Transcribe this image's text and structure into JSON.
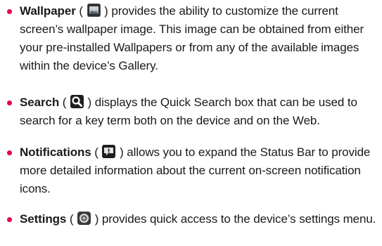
{
  "bullets": [
    {
      "term": "Wallpaper",
      "icon": "wallpaper-icon",
      "open": " ( ",
      "close": " ) ",
      "text": "provides the ability to customize the current screen’s wallpaper image. This image can be obtained from either your pre-installed Wallpapers or from any of the available images within the device’s Gallery."
    },
    {
      "term": "Search",
      "icon": "search-icon",
      "open": " ( ",
      "close": " ) ",
      "text": "displays the Quick Search box that can be used to search for a key term both on the device and on the Web."
    },
    {
      "term": "Notifications",
      "icon": "notification-icon",
      "open": " ( ",
      "close": " ) ",
      "text": "allows you to expand the Status Bar to provide more detailed information about the current on-screen notification icons."
    },
    {
      "term": "Settings",
      "icon": "settings-icon",
      "open": " ( ",
      "close": " ) ",
      "text": "provides quick access to the device’s settings menu."
    }
  ],
  "colors": {
    "bullet": "#e2005a",
    "text": "#1a1a1a"
  }
}
